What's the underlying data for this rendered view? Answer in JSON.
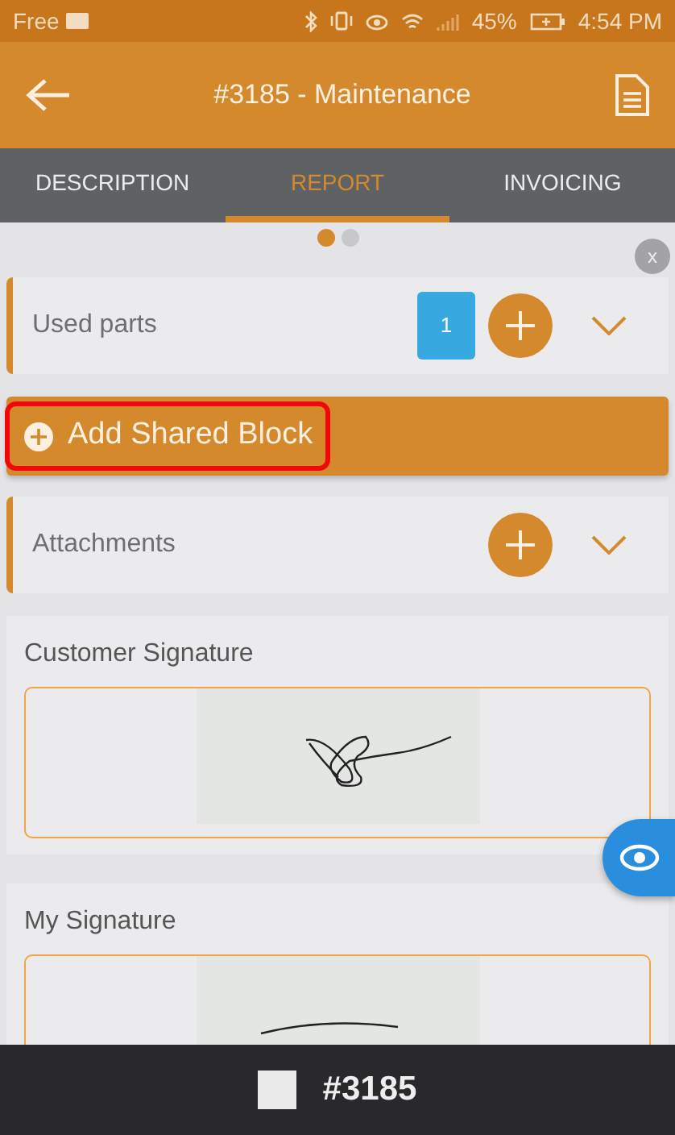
{
  "status_bar": {
    "carrier": "Free",
    "battery": "45%",
    "time": "4:54 PM"
  },
  "app_bar": {
    "title": "#3185 - Maintenance"
  },
  "tabs": [
    {
      "label": "DESCRIPTION",
      "selected": false
    },
    {
      "label": "REPORT",
      "selected": true
    },
    {
      "label": "INVOICING",
      "selected": false
    }
  ],
  "pager_dots": [
    {
      "selected": true
    },
    {
      "selected": false
    }
  ],
  "sections": [
    {
      "kind": "section",
      "title": "Used parts",
      "count": "1"
    },
    {
      "kind": "shared",
      "title": "Add Shared Block",
      "highlighted": true
    },
    {
      "kind": "section",
      "title": "Attachments"
    }
  ],
  "signatures": [
    {
      "title": "Customer Signature",
      "signed": true
    },
    {
      "title": "My Signature",
      "signed": true
    }
  ],
  "close_badge": "x",
  "bottom_bar": {
    "checked": false,
    "label": "#3185"
  }
}
